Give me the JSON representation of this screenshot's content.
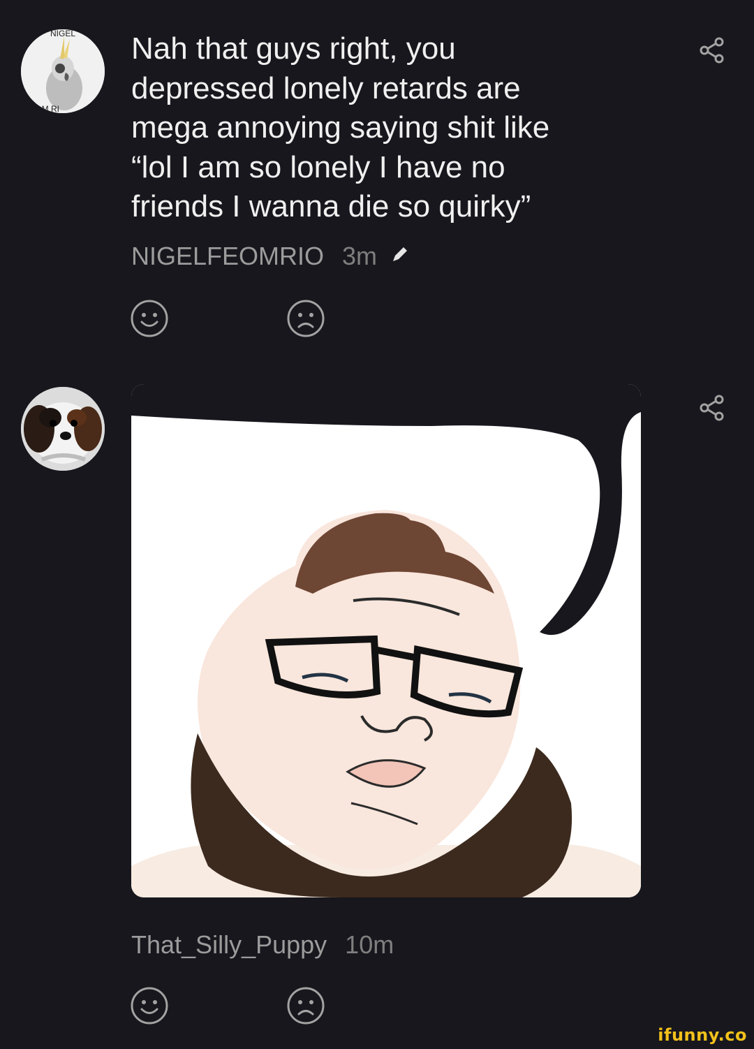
{
  "comments": [
    {
      "avatar_label_top": "NIGEL",
      "avatar_label_bottom": "FEOM RI",
      "text": "Nah that guys right, you\ndepressed lonely retards are\nmega annoying saying shit like\n“lol I am so lonely I have no\nfriends I wanna die so quirky”",
      "username": "NIGELFEOMRIO",
      "time": "3m",
      "edited_icon": "pencil-icon"
    },
    {
      "avatar_icon": "puppy-avatar",
      "image_icon": "bearded-guy-meme-image",
      "username": "That_Silly_Puppy",
      "time": "10m"
    }
  ],
  "icons": {
    "share": "share-icon",
    "upvote": "smile-icon",
    "downvote": "frown-icon"
  },
  "watermark": "ifunny.co",
  "colors": {
    "background": "#17171d",
    "text": "#f0f0f0",
    "meta": "#9c9c9c",
    "watermark": "#f2c11b"
  }
}
